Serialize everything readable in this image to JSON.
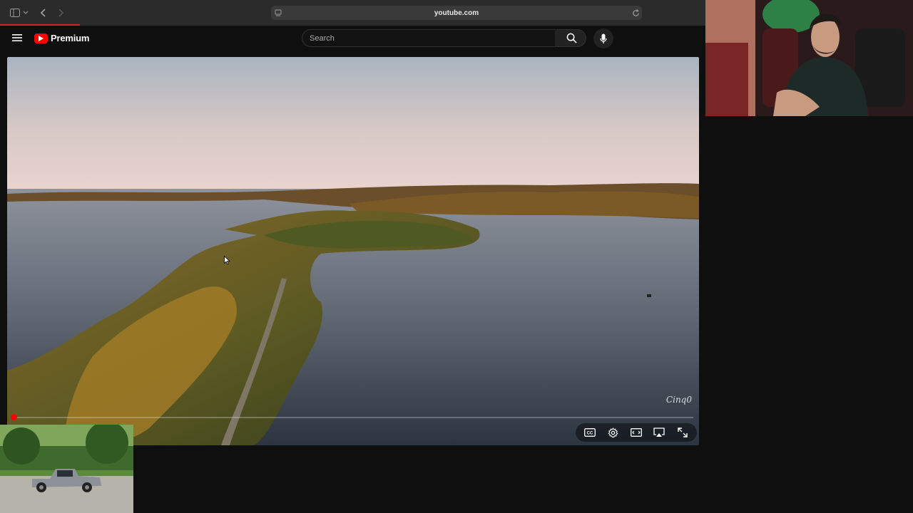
{
  "browser": {
    "url": "youtube.com"
  },
  "header": {
    "logo_text": "Premium",
    "search_placeholder": "Search",
    "brand_color": "#ff0000"
  },
  "video": {
    "watermark": "Cinq0",
    "progress_fraction": 0.004,
    "controls": [
      "cc-icon",
      "settings-icon",
      "theater-mode-icon",
      "airplay-icon",
      "fullscreen-icon"
    ]
  },
  "overlays": {
    "webcam_streamer": "streamer webcam feed",
    "webcam_truck": "pickup truck feed"
  }
}
